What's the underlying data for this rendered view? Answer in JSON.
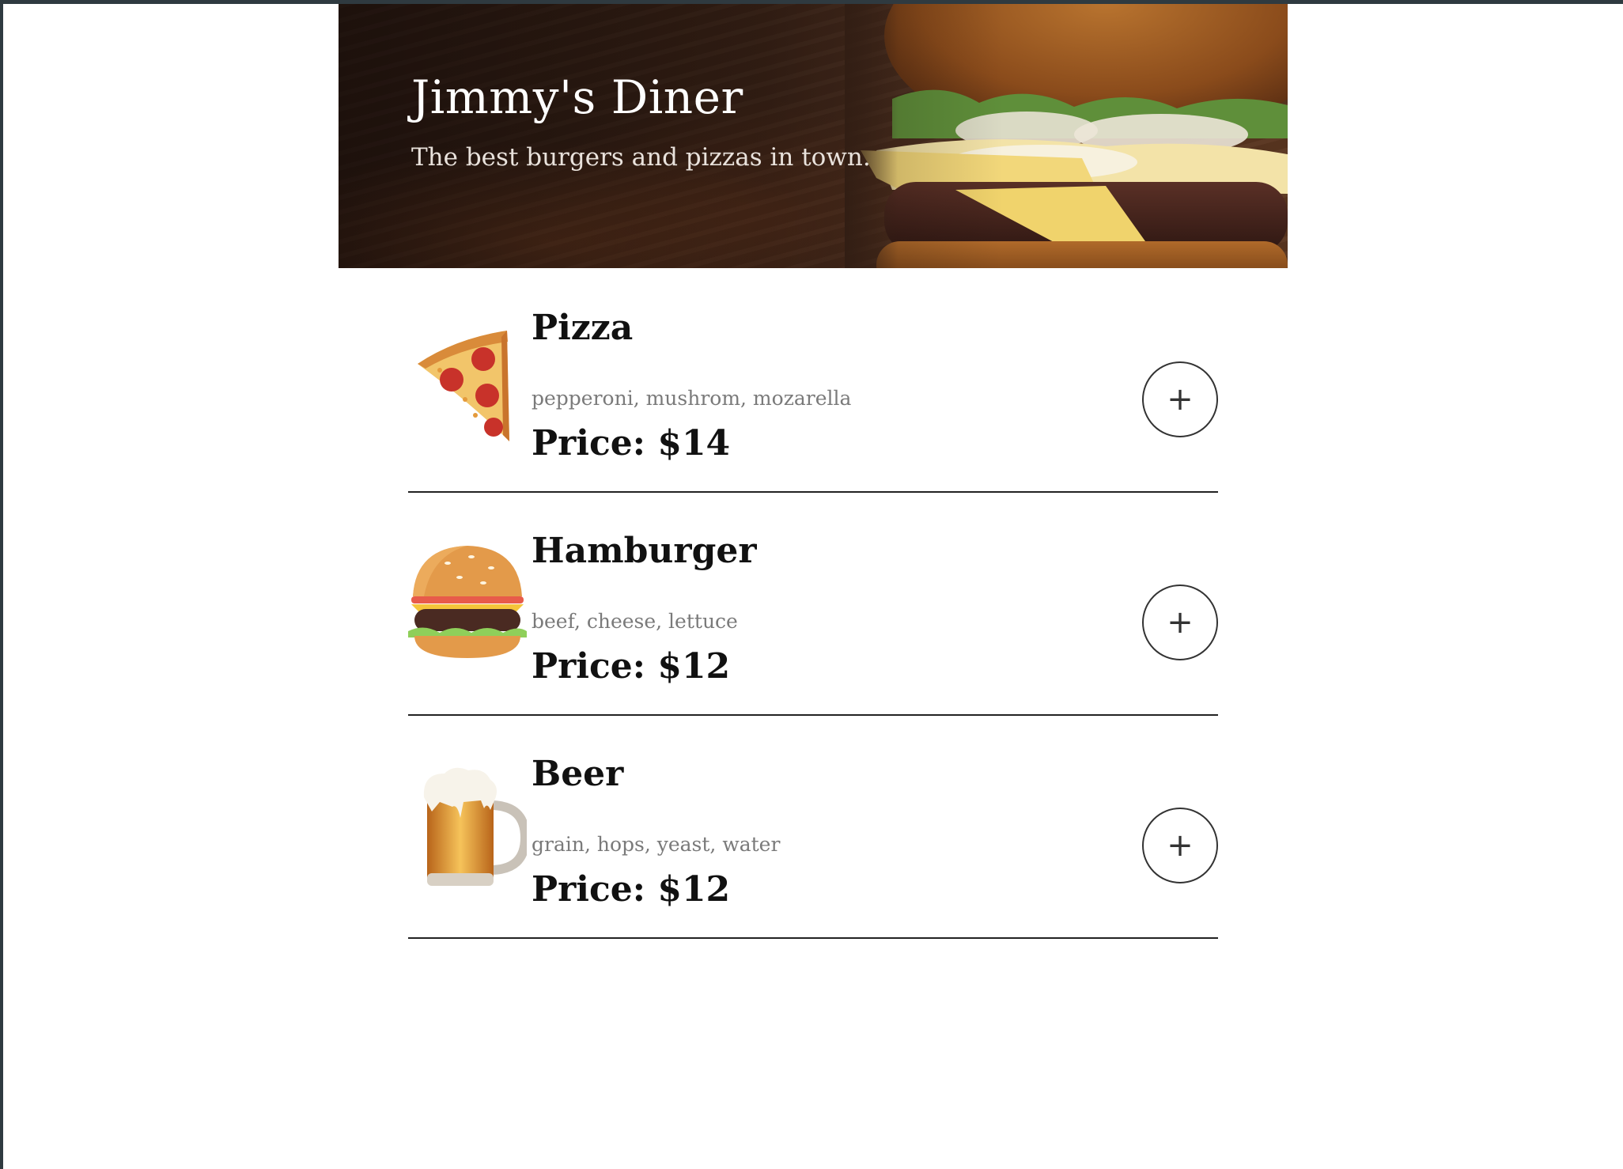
{
  "header": {
    "title": "Jimmy's Diner",
    "subtitle": "The best burgers and pizzas in town."
  },
  "menu": {
    "items": [
      {
        "name": "Pizza",
        "ingredients": "pepperoni, mushrom, mozarella",
        "price": "Price: $14",
        "icon": "pizza-icon",
        "add_label": "+"
      },
      {
        "name": "Hamburger",
        "ingredients": "beef, cheese, lettuce",
        "price": "Price: $12",
        "icon": "hamburger-icon",
        "add_label": "+"
      },
      {
        "name": "Beer",
        "ingredients": "grain, hops, yeast, water",
        "price": "Price: $12",
        "icon": "beer-icon",
        "add_label": "+"
      }
    ]
  },
  "colors": {
    "divider": "#222222",
    "ingredients_text": "#7a7a7a",
    "frame": "#2f3a40"
  }
}
